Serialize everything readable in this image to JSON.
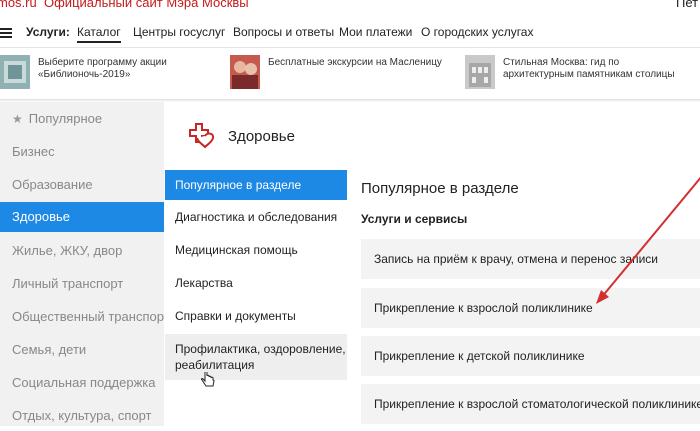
{
  "topbar": {
    "logo": "mos",
    "logo_suffix": ".ru",
    "site_title": "Официальный сайт Мэра Москвы",
    "user": "Пет"
  },
  "nav": {
    "services_label": "Услуги:",
    "items": [
      {
        "label": "Каталог",
        "active": true
      },
      {
        "label": "Центры госуслуг"
      },
      {
        "label": "Вопросы и ответы"
      },
      {
        "label": "Мои платежи"
      },
      {
        "label": "О городских услугах"
      }
    ]
  },
  "promos": [
    {
      "text": "Выберите программу акции «Библионочь-2019»"
    },
    {
      "text": "Бесплатные экскурсии на Масленицу"
    },
    {
      "text": "Стильная Москва: гид по архитектурным памятникам столицы"
    }
  ],
  "categories": [
    {
      "label": "Популярное",
      "icon": "star-icon"
    },
    {
      "label": "Бизнес"
    },
    {
      "label": "Образование"
    },
    {
      "label": "Здоровье",
      "active": true
    },
    {
      "label": "Жилье, ЖКУ, двор"
    },
    {
      "label": "Личный транспорт"
    },
    {
      "label": "Общественный транспорт"
    },
    {
      "label": "Семья, дети"
    },
    {
      "label": "Социальная поддержка"
    },
    {
      "label": "Отдых, культура, спорт"
    }
  ],
  "section": {
    "title": "Здоровье",
    "icon": "health-cross-heart-icon"
  },
  "submenu": [
    {
      "label": "Популярное в разделе",
      "active": true
    },
    {
      "label": "Диагностика и обследования"
    },
    {
      "label": "Медицинская помощь"
    },
    {
      "label": "Лекарства"
    },
    {
      "label": "Справки и документы"
    },
    {
      "label": "Профилактика, оздоровление, реабилитация",
      "hover": true
    }
  ],
  "content": {
    "title": "Популярное в разделе",
    "subtitle": "Услуги и сервисы",
    "cards": [
      "Запись на приём к врачу, отмена и перенос записи",
      "Прикрепление к взрослой поликлинике",
      "Прикрепление к детской поликлинике",
      "Прикрепление к взрослой стоматологической поликлинике"
    ]
  },
  "colors": {
    "accent": "#1e88e5",
    "brand_red": "#c41a1a",
    "annotation_arrow": "#d32f2f"
  }
}
